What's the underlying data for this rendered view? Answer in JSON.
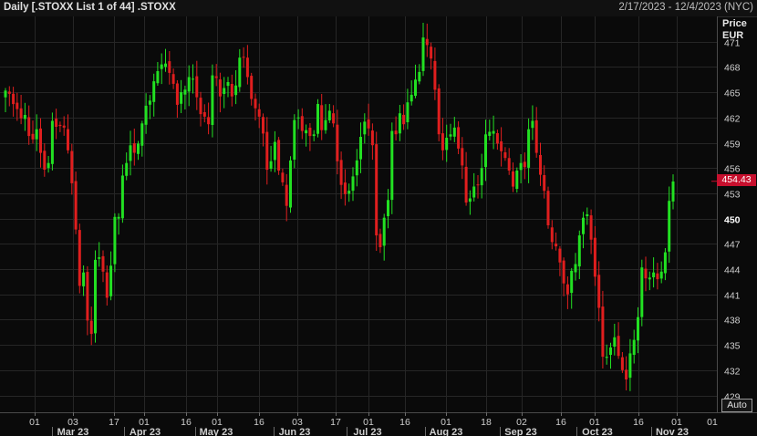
{
  "header": {
    "title": "Daily [.STOXX List 1 of 44] .STOXX",
    "date_range": "2/17/2023 - 12/4/2023 (NYC)"
  },
  "axis": {
    "price_label_line1": "Price",
    "price_label_line2": "EUR",
    "auto_button": "Auto",
    "last_price_label": "454.43"
  },
  "colors": {
    "background": "#0a0a0a",
    "grid": "#262626",
    "up": "#22e022",
    "down": "#e01e1e",
    "last_price_badge": "#c8102e"
  },
  "chart_data": {
    "type": "candlestick",
    "title": "Daily [.STOXX List 1 of 44] .STOXX",
    "instrument": ".STOXX",
    "currency": "EUR",
    "ylim": [
      427,
      474
    ],
    "y_ticks": [
      429,
      432,
      435,
      438,
      441,
      444,
      447,
      450,
      453,
      456,
      459,
      462,
      465,
      468,
      471
    ],
    "x_tick_labels": [
      "01",
      "03",
      "17",
      "01",
      "16",
      "01",
      "16",
      "03",
      "17",
      "01",
      "16",
      "01",
      "18",
      "02",
      "16",
      "01",
      "16",
      "01"
    ],
    "month_labels": [
      "Mar 23",
      "Apr 23",
      "May 23",
      "Jun 23",
      "Jul 23",
      "Aug 23",
      "Sep 23",
      "Oct 23",
      "Nov 23"
    ],
    "last_value": 454.43,
    "candles": {
      "up_color": "#22e022",
      "down_color": "#e01e1e",
      "close": [
        465.2,
        464.8,
        463.6,
        463.0,
        461.9,
        462.3,
        459.8,
        459.4,
        460.6,
        457.8,
        455.8,
        456.6,
        461.6,
        460.9,
        461.0,
        460.8,
        458.1,
        454.2,
        448.7,
        442.0,
        443.6,
        437.9,
        436.3,
        445.1,
        445.4,
        443.7,
        440.6,
        444.4,
        450.2,
        450.2,
        455.1,
        456.6,
        458.7,
        457.8,
        458.9,
        461.3,
        463.4,
        464.0,
        466.3,
        467.5,
        468.3,
        468.4,
        467.3,
        466.0,
        463.5,
        465.0,
        465.3,
        466.8,
        466.6,
        464.4,
        462.4,
        462.1,
        461.2,
        467.0,
        466.7,
        464.5,
        465.5,
        466.2,
        464.5,
        465.8,
        469.1,
        469.1,
        466.8,
        464.2,
        463.1,
        462.1,
        460.1,
        455.8,
        456.8,
        459.1,
        455.7,
        454.3,
        451.5,
        456.9,
        461.7,
        462.0,
        460.4,
        460.5,
        459.8,
        460.0,
        463.6,
        460.5,
        461.7,
        462.8,
        461.3,
        456.8,
        454.0,
        452.9,
        453.3,
        455.0,
        456.9,
        459.7,
        461.5,
        460.7,
        458.7,
        448.0,
        446.6,
        450.1,
        452.2,
        460.4,
        460.0,
        462.5,
        461.2,
        463.8,
        464.7,
        466.5,
        467.4,
        471.5,
        470.6,
        469.0,
        465.3,
        460.0,
        458.1,
        459.6,
        460.0,
        460.8,
        458.3,
        456.3,
        451.9,
        452.4,
        453.8,
        454.0,
        456.0,
        460.0,
        460.3,
        460.4,
        458.9,
        458.0,
        457.2,
        455.7,
        453.8,
        455.7,
        456.6,
        456.1,
        460.6,
        461.6,
        457.8,
        455.2,
        453.3,
        449.2,
        447.2,
        446.7,
        444.8,
        442.3,
        441.0,
        443.8,
        444.6,
        448.0,
        450.1,
        450.5,
        447.5,
        443.1,
        439.4,
        433.6,
        433.6,
        434.7,
        435.9,
        433.7,
        432.0,
        430.9,
        434.0,
        435.6,
        438.3,
        444.2,
        442.9,
        443.0,
        443.6,
        442.8,
        443.7,
        446.0,
        452.1,
        454.4
      ]
    }
  }
}
